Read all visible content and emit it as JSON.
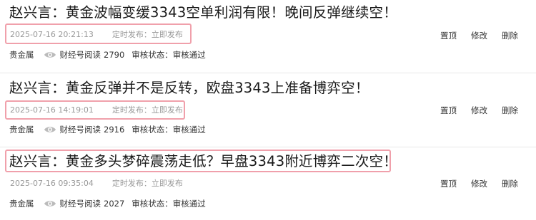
{
  "articles": [
    {
      "title": "赵兴言：黄金波幅变缓3343空单利润有限！晚间反弹继续空！",
      "time": "2025-07-16 20:21:13",
      "schedule": "定时发布：立即发布",
      "category": "贵金属",
      "reads_label": "财经号阅读",
      "reads": "2790",
      "review_label": "审核状态：",
      "review_status": "审核通过",
      "actions": {
        "pin": "置顶",
        "edit": "修改",
        "delete": "删除"
      }
    },
    {
      "title": "赵兴言：黄金反弹并不是反转，欧盘3343上准备博弈空！",
      "time": "2025-07-16 14:19:01",
      "schedule": "定时发布：立即发布",
      "category": "贵金属",
      "reads_label": "财经号阅读",
      "reads": "2916",
      "review_label": "审核状态：",
      "review_status": "审核通过",
      "actions": {
        "pin": "置顶",
        "edit": "修改",
        "delete": "删除"
      }
    },
    {
      "title": "赵兴言：黄金多头梦碎震荡走低？早盘3343附近博弈二次空！",
      "time": "2025-07-16 09:35:04",
      "schedule": "定时发布：立即发布",
      "category": "贵金属",
      "reads_label": "财经号阅读",
      "reads": "2027",
      "review_label": "审核状态：",
      "review_status": "审核通过",
      "actions": {
        "pin": "置顶",
        "edit": "修改",
        "delete": "删除"
      }
    }
  ],
  "icons": {
    "views": "eye-icon"
  },
  "colors": {
    "highlight_box": "#f0a0ab",
    "meta_text": "#999999"
  }
}
